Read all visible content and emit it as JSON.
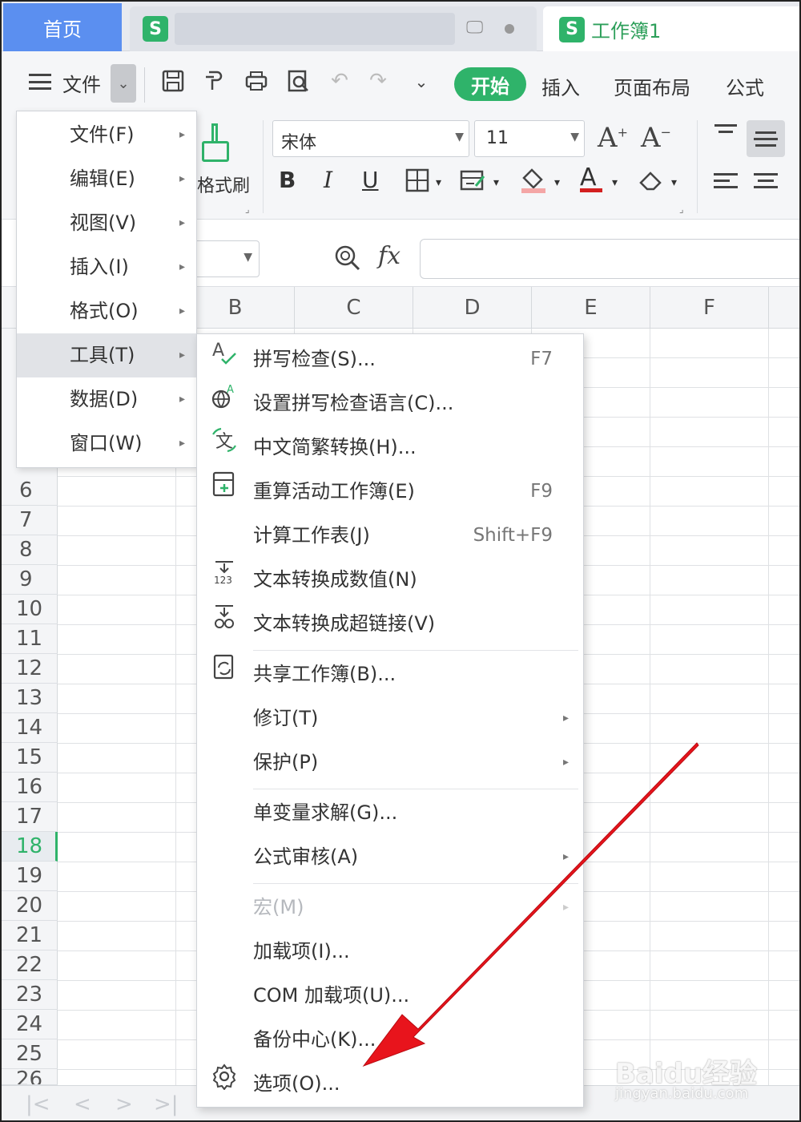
{
  "tabs": {
    "home": "首页",
    "doc1_logo": "S",
    "doc2_logo": "S",
    "doc2_title": "工作簿1"
  },
  "toolbar": {
    "file_label": "文件",
    "ribbon_tabs": [
      "开始",
      "插入",
      "页面布局",
      "公式"
    ]
  },
  "ribbon": {
    "format_painter": "格式刷",
    "font_name": "宋体",
    "font_size": "11",
    "bold": "B",
    "italic": "I",
    "underline": "U",
    "grow_font": "A",
    "shrink_font": "A",
    "font_color": "A"
  },
  "formula_bar": {
    "fx": "fx"
  },
  "sheet": {
    "columns": [
      "B",
      "C",
      "D",
      "E",
      "F"
    ],
    "rows": [
      "6",
      "7",
      "8",
      "9",
      "10",
      "11",
      "12",
      "13",
      "14",
      "15",
      "16",
      "17",
      "18",
      "19",
      "20",
      "21",
      "22",
      "23",
      "24",
      "25",
      "26"
    ],
    "active_row": "18"
  },
  "main_menu": {
    "items": [
      {
        "label": "文件(F)"
      },
      {
        "label": "编辑(E)"
      },
      {
        "label": "视图(V)"
      },
      {
        "label": "插入(I)"
      },
      {
        "label": "格式(O)"
      },
      {
        "label": "工具(T)"
      },
      {
        "label": "数据(D)"
      },
      {
        "label": "窗口(W)"
      }
    ],
    "active": "工具(T)"
  },
  "tools_menu": {
    "items": [
      {
        "label": "拼写检查(S)...",
        "shortcut": "F7",
        "icon": "spellcheck-icon"
      },
      {
        "label": "设置拼写检查语言(C)...",
        "icon": "spell-language-icon"
      },
      {
        "label": "中文简繁转换(H)...",
        "icon": "chinese-convert-icon"
      },
      {
        "label": "重算活动工作簿(E)",
        "shortcut": "F9",
        "icon": "recalculate-icon"
      },
      {
        "label": "计算工作表(J)",
        "shortcut": "Shift+F9"
      },
      {
        "label": "文本转换成数值(N)",
        "icon": "text-to-number-icon"
      },
      {
        "label": "文本转换成超链接(V)",
        "icon": "text-to-link-icon"
      },
      {
        "label": "共享工作簿(B)...",
        "icon": "share-workbook-icon"
      },
      {
        "label": "修订(T)"
      },
      {
        "label": "保护(P)"
      },
      {
        "label": "单变量求解(G)..."
      },
      {
        "label": "公式审核(A)"
      },
      {
        "label": "宏(M)"
      },
      {
        "label": "加载项(I)..."
      },
      {
        "label": "COM 加载项(U)..."
      },
      {
        "label": "备份中心(K)..."
      },
      {
        "label": "选项(O)...",
        "icon": "gear-icon"
      }
    ]
  },
  "watermark": {
    "brand": "Baidu经验",
    "url": "jingyan.baidu.com"
  },
  "colors": {
    "accent": "#2fb36a",
    "home_tab": "#5b8ff0",
    "annotation_arrow": "#e8141c"
  }
}
